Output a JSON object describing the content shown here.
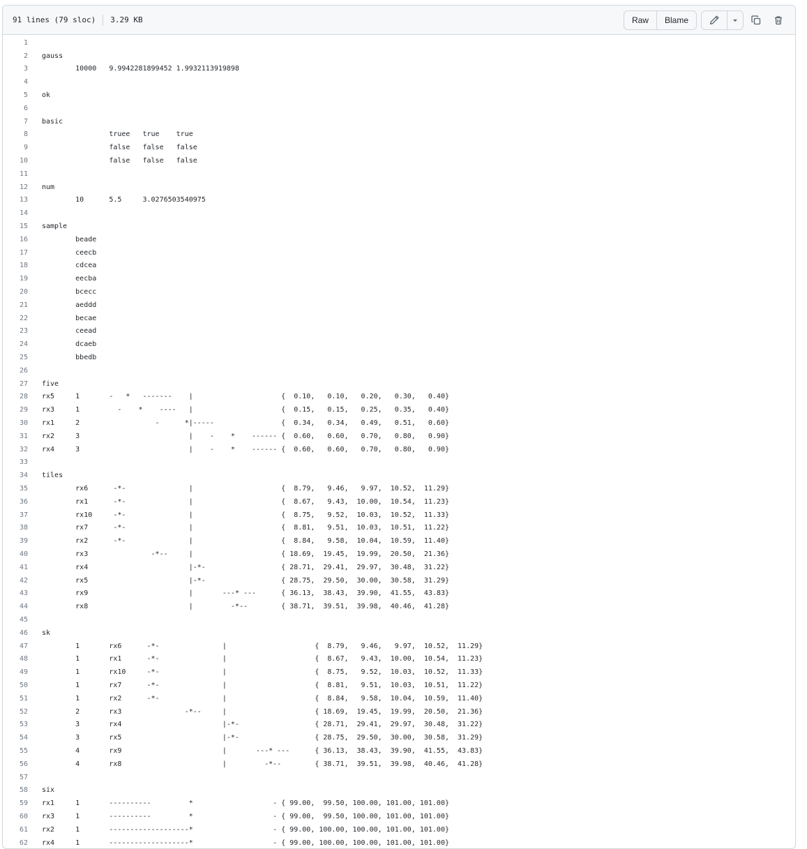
{
  "file_info": {
    "lines": "91 lines (79 sloc)",
    "size": "3.29 KB"
  },
  "toolbar": {
    "raw_label": "Raw",
    "blame_label": "Blame",
    "edit_icon": "pencil-icon",
    "dropdown_icon": "chevron-down-icon",
    "copy_icon": "copy-icon",
    "delete_icon": "trash-icon"
  },
  "code_lines": [
    {
      "n": "1",
      "text": ""
    },
    {
      "n": "2",
      "text": "gauss"
    },
    {
      "n": "3",
      "text": "        10000   9.9942281899452 1.9932113919898"
    },
    {
      "n": "4",
      "text": ""
    },
    {
      "n": "5",
      "text": "ok"
    },
    {
      "n": "6",
      "text": ""
    },
    {
      "n": "7",
      "text": "basic"
    },
    {
      "n": "8",
      "text": "                truee   true    true"
    },
    {
      "n": "9",
      "text": "                false   false   false"
    },
    {
      "n": "10",
      "text": "                false   false   false"
    },
    {
      "n": "11",
      "text": ""
    },
    {
      "n": "12",
      "text": "num"
    },
    {
      "n": "13",
      "text": "        10      5.5     3.0276503540975"
    },
    {
      "n": "14",
      "text": ""
    },
    {
      "n": "15",
      "text": "sample"
    },
    {
      "n": "16",
      "text": "        beade"
    },
    {
      "n": "17",
      "text": "        ceecb"
    },
    {
      "n": "18",
      "text": "        cdcea"
    },
    {
      "n": "19",
      "text": "        eecba"
    },
    {
      "n": "20",
      "text": "        bcecc"
    },
    {
      "n": "21",
      "text": "        aeddd"
    },
    {
      "n": "22",
      "text": "        becae"
    },
    {
      "n": "23",
      "text": "        ceead"
    },
    {
      "n": "24",
      "text": "        dcaeb"
    },
    {
      "n": "25",
      "text": "        bbedb"
    },
    {
      "n": "26",
      "text": ""
    },
    {
      "n": "27",
      "text": "five"
    },
    {
      "n": "28",
      "text": "rx5     1       -   *   -------    |                     {  0.10,   0.10,   0.20,   0.30,   0.40}"
    },
    {
      "n": "29",
      "text": "rx3     1         -    *    ----   |                     {  0.15,   0.15,   0.25,   0.35,   0.40}"
    },
    {
      "n": "30",
      "text": "rx1     2                  -      *|-----                {  0.34,   0.34,   0.49,   0.51,   0.60}"
    },
    {
      "n": "31",
      "text": "rx2     3                          |    -    *    ------ {  0.60,   0.60,   0.70,   0.80,   0.90}"
    },
    {
      "n": "32",
      "text": "rx4     3                          |    -    *    ------ {  0.60,   0.60,   0.70,   0.80,   0.90}"
    },
    {
      "n": "33",
      "text": ""
    },
    {
      "n": "34",
      "text": "tiles"
    },
    {
      "n": "35",
      "text": "        rx6      -*-               |                     {  8.79,   9.46,   9.97,  10.52,  11.29}"
    },
    {
      "n": "36",
      "text": "        rx1      -*-               |                     {  8.67,   9.43,  10.00,  10.54,  11.23}"
    },
    {
      "n": "37",
      "text": "        rx10     -*-               |                     {  8.75,   9.52,  10.03,  10.52,  11.33}"
    },
    {
      "n": "38",
      "text": "        rx7      -*-               |                     {  8.81,   9.51,  10.03,  10.51,  11.22}"
    },
    {
      "n": "39",
      "text": "        rx2      -*-               |                     {  8.84,   9.58,  10.04,  10.59,  11.40}"
    },
    {
      "n": "40",
      "text": "        rx3               -*--     |                     { 18.69,  19.45,  19.99,  20.50,  21.36}"
    },
    {
      "n": "41",
      "text": "        rx4                        |-*-                  { 28.71,  29.41,  29.97,  30.48,  31.22}"
    },
    {
      "n": "42",
      "text": "        rx5                        |-*-                  { 28.75,  29.50,  30.00,  30.58,  31.29}"
    },
    {
      "n": "43",
      "text": "        rx9                        |       ---* ---      { 36.13,  38.43,  39.90,  41.55,  43.83}"
    },
    {
      "n": "44",
      "text": "        rx8                        |         -*--        { 38.71,  39.51,  39.98,  40.46,  41.28}"
    },
    {
      "n": "45",
      "text": ""
    },
    {
      "n": "46",
      "text": "sk"
    },
    {
      "n": "47",
      "text": "        1       rx6      -*-               |                     {  8.79,   9.46,   9.97,  10.52,  11.29}"
    },
    {
      "n": "48",
      "text": "        1       rx1      -*-               |                     {  8.67,   9.43,  10.00,  10.54,  11.23}"
    },
    {
      "n": "49",
      "text": "        1       rx10     -*-               |                     {  8.75,   9.52,  10.03,  10.52,  11.33}"
    },
    {
      "n": "50",
      "text": "        1       rx7      -*-               |                     {  8.81,   9.51,  10.03,  10.51,  11.22}"
    },
    {
      "n": "51",
      "text": "        1       rx2      -*-               |                     {  8.84,   9.58,  10.04,  10.59,  11.40}"
    },
    {
      "n": "52",
      "text": "        2       rx3               -*--     |                     { 18.69,  19.45,  19.99,  20.50,  21.36}"
    },
    {
      "n": "53",
      "text": "        3       rx4                        |-*-                  { 28.71,  29.41,  29.97,  30.48,  31.22}"
    },
    {
      "n": "54",
      "text": "        3       rx5                        |-*-                  { 28.75,  29.50,  30.00,  30.58,  31.29}"
    },
    {
      "n": "55",
      "text": "        4       rx9                        |       ---* ---      { 36.13,  38.43,  39.90,  41.55,  43.83}"
    },
    {
      "n": "56",
      "text": "        4       rx8                        |         -*--        { 38.71,  39.51,  39.98,  40.46,  41.28}"
    },
    {
      "n": "57",
      "text": ""
    },
    {
      "n": "58",
      "text": "six"
    },
    {
      "n": "59",
      "text": "rx1     1       ----------         *                   - { 99.00,  99.50, 100.00, 101.00, 101.00}"
    },
    {
      "n": "60",
      "text": "rx3     1       ----------         *                   - { 99.00,  99.50, 100.00, 101.00, 101.00}"
    },
    {
      "n": "61",
      "text": "rx2     1       -------------------*                   - { 99.00, 100.00, 100.00, 101.00, 101.00}"
    },
    {
      "n": "62",
      "text": "rx4     1       -------------------*                   - { 99.00, 100.00, 100.00, 101.00, 101.00}"
    }
  ]
}
